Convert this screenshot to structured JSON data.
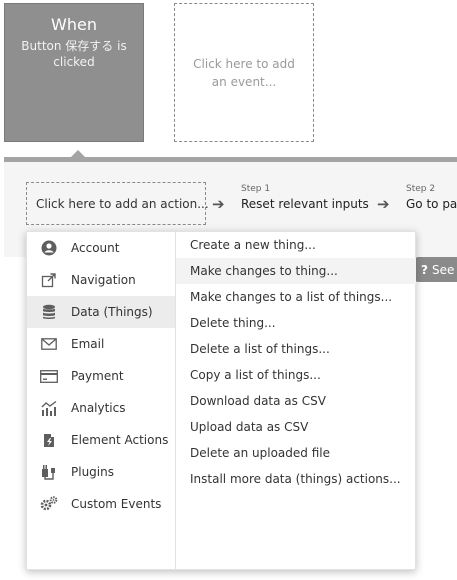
{
  "event": {
    "title": "When",
    "description": "Button 保存する is clicked",
    "add_event_label": "Click here to add an event..."
  },
  "workflow": {
    "add_action_label": "Click here to add an action...",
    "steps": [
      {
        "label": "Step 1",
        "title": "Reset relevant inputs"
      },
      {
        "label": "Step 2",
        "title": "Go to page"
      }
    ],
    "see_button": {
      "icon": "?",
      "label": "See"
    }
  },
  "dropdown": {
    "categories": [
      {
        "label": "Account",
        "icon": "account-icon"
      },
      {
        "label": "Navigation",
        "icon": "navigation-icon"
      },
      {
        "label": "Data (Things)",
        "icon": "database-icon",
        "selected": true
      },
      {
        "label": "Email",
        "icon": "email-icon"
      },
      {
        "label": "Payment",
        "icon": "payment-icon"
      },
      {
        "label": "Analytics",
        "icon": "analytics-icon"
      },
      {
        "label": "Element Actions",
        "icon": "element-actions-icon"
      },
      {
        "label": "Plugins",
        "icon": "plugins-icon"
      },
      {
        "label": "Custom Events",
        "icon": "custom-events-icon"
      }
    ],
    "actions": [
      {
        "label": "Create a new thing..."
      },
      {
        "label": "Make changes to thing...",
        "hovered": true
      },
      {
        "label": "Make changes to a list of things..."
      },
      {
        "label": "Delete thing..."
      },
      {
        "label": "Delete a list of things..."
      },
      {
        "label": "Copy a list of things..."
      },
      {
        "label": "Download data as CSV"
      },
      {
        "label": "Upload data as CSV"
      },
      {
        "label": "Delete an uploaded file"
      },
      {
        "label": "Install more data (things) actions..."
      }
    ]
  },
  "colors": {
    "event_card": "#8f8f8f",
    "panel_bar": "#a4a4a4",
    "selected_row": "#ececec",
    "icon": "#5e5e5e"
  }
}
